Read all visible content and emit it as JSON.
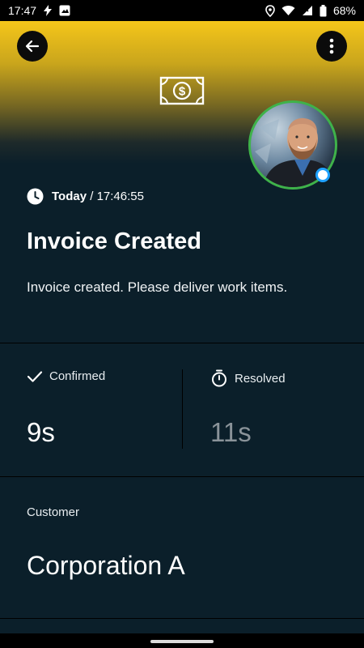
{
  "status_bar": {
    "time": "17:47",
    "battery": "68%"
  },
  "header": {
    "back_icon": "arrow-left-icon",
    "more_icon": "more-vertical-icon",
    "money_icon": "money-bill-icon"
  },
  "event": {
    "day": "Today",
    "separator": " / ",
    "time": "17:46:55",
    "title": "Invoice Created",
    "description": "Invoice created. Please deliver work items."
  },
  "stats": {
    "confirmed_label": "Confirmed",
    "confirmed_value": "9s",
    "resolved_label": "Resolved",
    "resolved_value": "11s"
  },
  "customer": {
    "label": "Customer",
    "value": "Corporation A"
  },
  "colors": {
    "background": "#0b1f2a",
    "header_yellow": "#f5c61a",
    "avatar_ring": "#3fb24a",
    "status_dot": "#1ea1ff"
  }
}
